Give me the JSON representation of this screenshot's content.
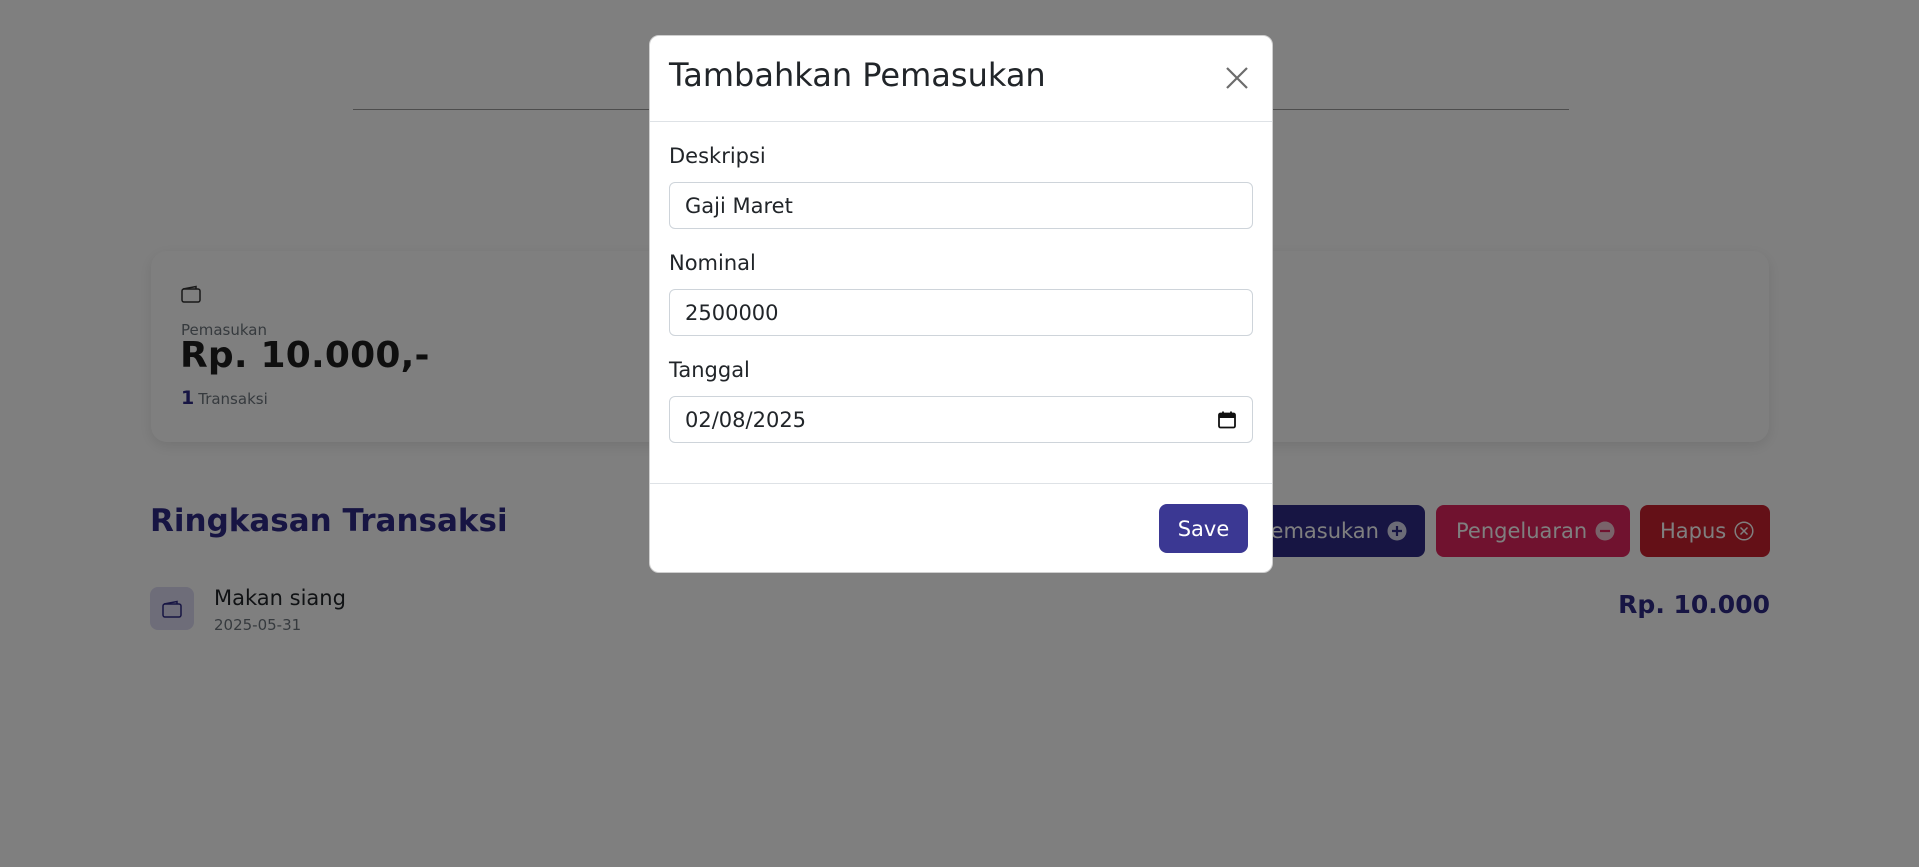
{
  "card": {
    "label": "Pemasukan",
    "amount": "Rp. 10.000,-",
    "count": "1",
    "count_suffix": "Transaksi"
  },
  "summary": {
    "title": "Ringkasan Transaksi",
    "buttons": {
      "income": "Pemasukan",
      "expense": "Pengeluaran",
      "delete": "Hapus"
    },
    "transactions": [
      {
        "name": "Makan siang",
        "date": "2025-05-31",
        "amount": "Rp. 10.000"
      }
    ]
  },
  "modal": {
    "title": "Tambahkan Pemasukan",
    "fields": [
      {
        "label": "Deskripsi",
        "value": "Gaji Maret"
      },
      {
        "label": "Nominal",
        "value": "2500000"
      },
      {
        "label": "Tanggal",
        "value": "02/08/2025"
      }
    ],
    "save_label": "Save"
  },
  "colors": {
    "primary": "#2e2a86",
    "expense": "#e0245e",
    "danger": "#c8202e",
    "save": "#3b3893",
    "overlay": "rgba(0,0,0,0.5)"
  },
  "icons": [
    "wallet-icon",
    "plus-circle-icon",
    "minus-circle-icon",
    "x-circle-icon",
    "close-icon",
    "calendar-icon"
  ]
}
